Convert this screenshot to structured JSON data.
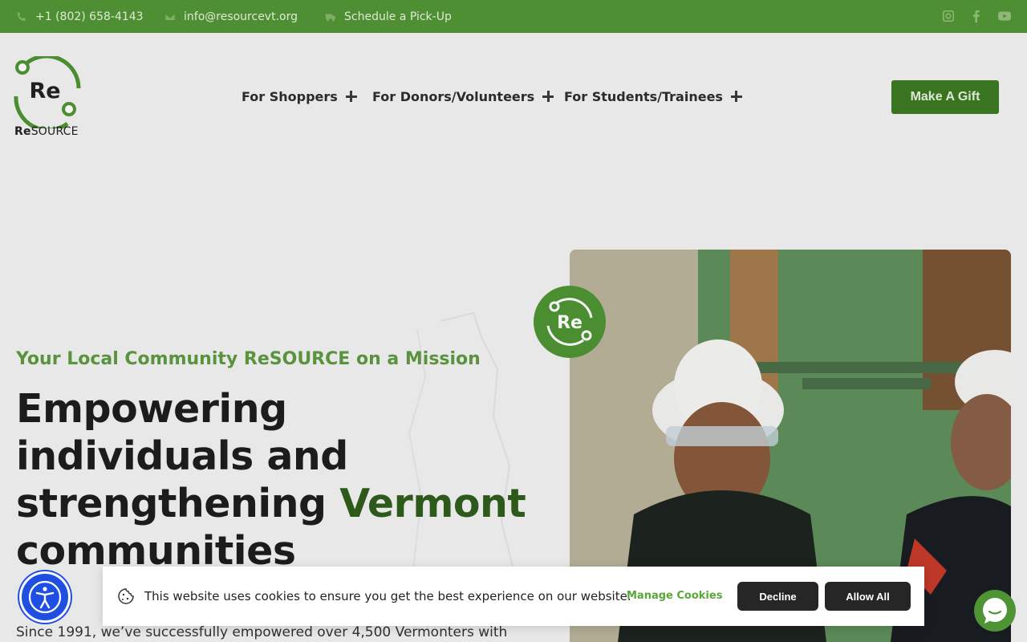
{
  "topbar": {
    "phone": "+1 (802) 658-4143",
    "email": "info@resourcevt.org",
    "pickup": "Schedule a Pick-Up",
    "social": [
      "instagram-icon",
      "facebook-icon",
      "youtube-icon"
    ]
  },
  "logo": {
    "mark": "Re",
    "word_bold": "Re",
    "word_rest": "SOURCE"
  },
  "nav": [
    {
      "label": "For Shoppers"
    },
    {
      "label": "For Donors/Volunteers"
    },
    {
      "label": "For Students/Trainees"
    }
  ],
  "cta": {
    "gift": "Make A Gift"
  },
  "hero": {
    "eyebrow": "Your Local Community ReSOURCE on a Mission",
    "headline_1": "Empowering individuals and strengthening",
    "headline_accent": "Vermont",
    "headline_2": "communities",
    "sub": "Since 1991, we’ve successfully empowered over 4,500 Vermonters with",
    "badge": "Re"
  },
  "cookie": {
    "text": "This website uses cookies to ensure you get the best experience on our website.",
    "manage": "Manage Cookies",
    "decline": "Decline",
    "allow": "Allow All"
  },
  "colors": {
    "brand_green": "#4f8f33",
    "dark_green": "#3c7a22",
    "accessibility_blue": "#1f4fe0"
  }
}
